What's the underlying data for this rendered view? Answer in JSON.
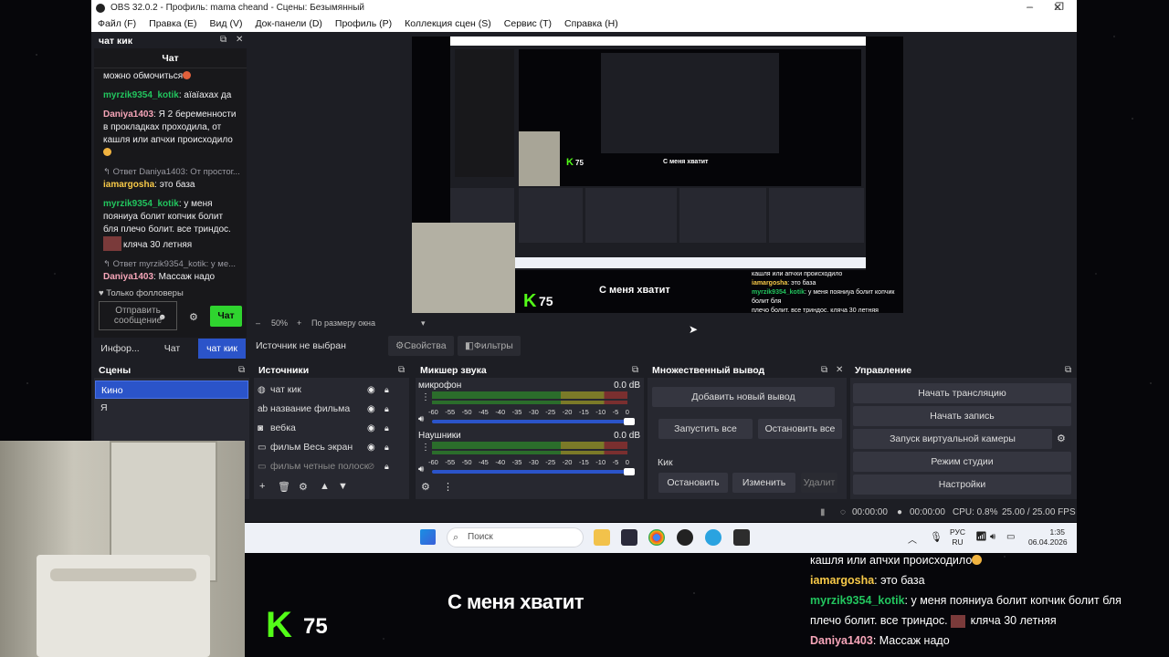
{
  "window": {
    "title": "OBS 32.0.2 - Профиль: mama cheand - Сцены: Безымянный"
  },
  "menu": [
    "Файл (F)",
    "Правка (E)",
    "Вид (V)",
    "Док-панели (D)",
    "Профиль (P)",
    "Коллекция сцен (S)",
    "Сервис (T)",
    "Справка (H)"
  ],
  "chat_dock": {
    "dock_title": "чат кик",
    "header": "Чат",
    "messages": [
      {
        "user": "",
        "text": "можно обмочиться"
      },
      {
        "user": "myrzik9354_kotik",
        "color": "#22c55e",
        "text": ": аïаïахах да"
      },
      {
        "user": "Daniya1403",
        "color": "#f6a5b8",
        "text": ": Я 2 беременности в прокладках проходила, от кашля или апчхи происходило"
      },
      {
        "reply": "Ответ Daniya1403: От простог...",
        "user": "iamargosha",
        "color": "#f7c948",
        "text": ": это база"
      },
      {
        "user": "myrzik9354_kotik",
        "color": "#22c55e",
        "text": ": у меня пояниуа болит копчик болит бля плечо болит. все триндос.",
        "tail": "кляча 30 летняя"
      },
      {
        "reply": "Ответ myrzik9354_kotik: у ме...",
        "user": "Daniya1403",
        "color": "#f6a5b8",
        "text": ": Массаж надо"
      }
    ],
    "followers_only": "Только фолловеры",
    "input_placeholder": "Отправить сообщение",
    "send_label": "Чат",
    "tabs": [
      "Инфор...",
      "Чат",
      "чат кик"
    ]
  },
  "preview": {
    "zoom": "50%",
    "fit": "По размеру окна",
    "no_source": "Источник не выбран",
    "properties": "Свойства",
    "filters": "Фильтры"
  },
  "scenes": {
    "title": "Сцены",
    "items": [
      "Кино",
      "Я"
    ],
    "selected": 0
  },
  "sources": {
    "title": "Источники",
    "items": [
      {
        "name": "чат кик",
        "icon": "globe-icon"
      },
      {
        "name": "название фильма",
        "icon": "text-icon"
      },
      {
        "name": "вебка",
        "icon": "camera-icon"
      },
      {
        "name": "фильм Весь экран",
        "icon": "monitor-icon"
      },
      {
        "name": "фильм четные полоск",
        "icon": "monitor-icon",
        "hidden": true
      }
    ]
  },
  "mixer": {
    "title": "Микшер звука",
    "channels": [
      {
        "name": "микрофон",
        "db": "0.0 dB",
        "level": 1.0
      },
      {
        "name": "Наушники",
        "db": "0.0 dB",
        "level": 1.0
      }
    ],
    "scale": [
      "-60",
      "-55",
      "-50",
      "-45",
      "-40",
      "-35",
      "-30",
      "-25",
      "-20",
      "-15",
      "-10",
      "-5",
      "0"
    ]
  },
  "multi": {
    "title": "Множественный вывод",
    "add": "Добавить новый вывод",
    "start_all": "Запустить все",
    "stop_all": "Остановить все",
    "target": "Кик",
    "stop": "Остановить",
    "edit": "Изменить",
    "delete": "Удалит"
  },
  "controls": {
    "title": "Управление",
    "buttons": [
      "Начать трансляцию",
      "Начать запись",
      "Запуск виртуальной камеры",
      "Режим студии",
      "Настройки"
    ]
  },
  "status": {
    "stream_time": "00:00:00",
    "rec_time": "00:00:00",
    "cpu": "CPU: 0.8%",
    "fps": "25.00 / 25.00 FPS"
  },
  "taskbar": {
    "search": "Поиск",
    "lang": "РУС",
    "region": "RU",
    "time": "1:35",
    "date": "06.04.2026"
  },
  "overlay": {
    "kick_count": "75",
    "subtitle": "С меня хватит",
    "chat": [
      {
        "user": "",
        "text": "кашля или апчхи происходило"
      },
      {
        "user": "iamargosha",
        "color": "#f7c948",
        "text": ": это база"
      },
      {
        "user": "myrzik9354_kotik",
        "color": "#22c55e",
        "text": ": у меня пояниуа болит копчик болит бля"
      },
      {
        "user": "",
        "text": "плечо болит. все триндос.",
        "tail": "кляча 30 летняя"
      },
      {
        "user": "Daniya1403",
        "color": "#f6a5b8",
        "text": ": Массаж надо"
      }
    ]
  },
  "colors": {
    "accent": "#2b54c9",
    "kick_green": "#53fc18",
    "panel": "#272830",
    "bg": "#1d1e24"
  }
}
